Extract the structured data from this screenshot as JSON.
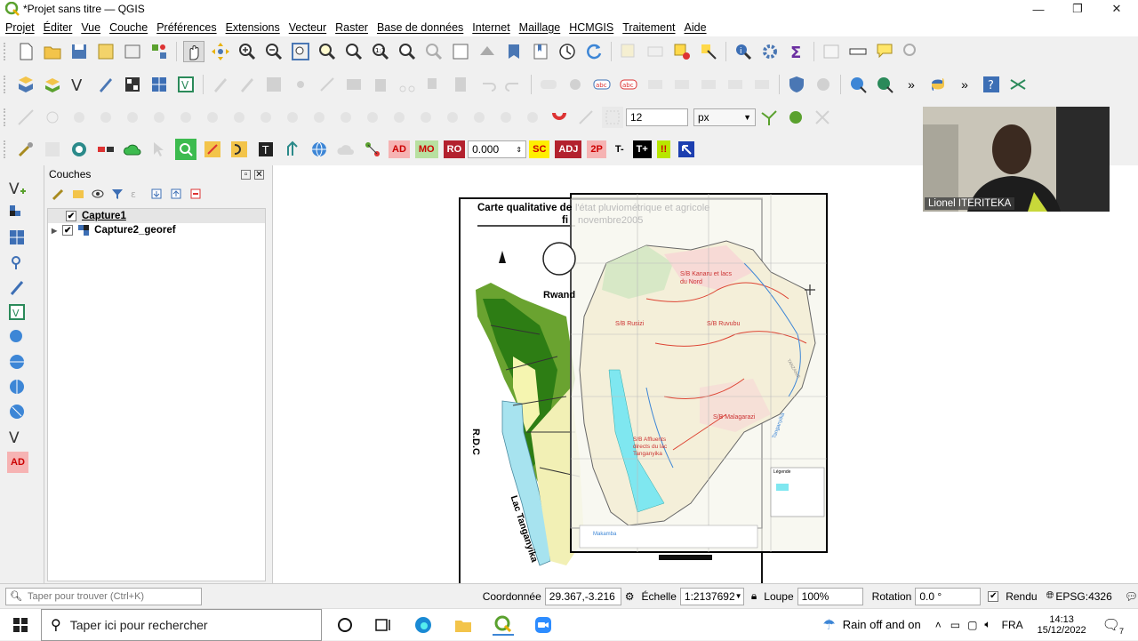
{
  "window": {
    "title": "*Projet sans titre — QGIS"
  },
  "menu": [
    "Projet",
    "Éditer",
    "Vue",
    "Couche",
    "Préférences",
    "Extensions",
    "Vecteur",
    "Raster",
    "Base de données",
    "Internet",
    "Maillage",
    "HCMGIS",
    "Traitement",
    "Aide"
  ],
  "toolbar3": {
    "size_value": "12",
    "unit_value": "px"
  },
  "toolbar4": {
    "offset_value": "0.000",
    "tags": [
      "AD",
      "MO",
      "RO",
      "SC",
      "ADJ",
      "2P",
      "T-",
      "T+",
      "!!"
    ]
  },
  "layers_panel": {
    "title": "Couches",
    "layers": [
      {
        "name": "Capture1",
        "checked": true
      },
      {
        "name": "Capture2_georef",
        "checked": true
      }
    ]
  },
  "map": {
    "title_left_1": "Carte qualitative de",
    "title_left_2": "fi",
    "title_right_1": "l'état pluviométrique et agricole",
    "title_right_2": "novembre2005",
    "labels": {
      "rwanda": "Rwand",
      "rdc": "R.D.C",
      "lac": "Lac Tanganyika",
      "sib_kanaru": "S/B Kanaru et lacs du Nord",
      "sib_rusizi": "S/B Rusizi",
      "sib_ruvubu": "S/B Ruvubu",
      "sib_malagarazi": "S/B Malagarazi",
      "sib_affluents": "S/B Affluents directs du lac Tanganyika",
      "legende": "Légende",
      "makamba": "Makamba",
      "tanzanie": "TANZANIE",
      "tanganyika": "Tanganyika"
    }
  },
  "webcam": {
    "name": "Lionel ITERITEKA"
  },
  "status": {
    "search_placeholder": "Taper pour trouver (Ctrl+K)",
    "coord_label": "Coordonnée",
    "coord_value": "29.367,-3.216",
    "scale_label": "Échelle",
    "scale_value": "1:2137692",
    "magnifier_label": "Loupe",
    "magnifier_value": "100%",
    "rotation_label": "Rotation",
    "rotation_value": "0.0 °",
    "render_label": "Rendu",
    "crs": "EPSG:4326"
  },
  "taskbar": {
    "search_placeholder": "Taper ici pour rechercher",
    "weather": "Rain off and on",
    "lang": "FRA",
    "time": "14:13",
    "date": "15/12/2022",
    "notif_count": "7"
  },
  "colors": {
    "accent": "#1a73c6",
    "qgis_green": "#5aa12e",
    "dark_green": "#2d7d14",
    "lake": "#a7e3ef"
  }
}
